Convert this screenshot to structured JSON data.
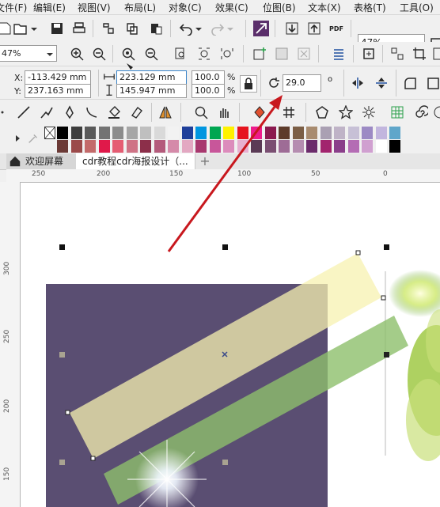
{
  "menu": [
    "文件(F)",
    "编辑(E)",
    "视图(V)",
    "布局(L)",
    "对象(C)",
    "效果(C)",
    "位图(B)",
    "文本(X)",
    "表格(T)",
    "工具(O)"
  ],
  "toolbar": {
    "zoom_level": "47%",
    "snap_level": "47%"
  },
  "property_bar": {
    "x_label": "X:",
    "x_value": "-113.429 mm",
    "y_label": "Y:",
    "y_value": "237.163 mm",
    "width_value": "223.129 mm",
    "height_value": "145.947 mm",
    "scale_x": "100.0",
    "scale_y": "100.0",
    "percent": "%",
    "rotation_value": "29.0",
    "rotation_unit": "o"
  },
  "palette": {
    "row1": [
      "#000000",
      "#3d3d3d",
      "#595959",
      "#737373",
      "#8c8c8c",
      "#a6a6a6",
      "#bfbfbf",
      "#d9d9d9",
      "#f2f2f2",
      "#1e3f9a",
      "#0096e0",
      "#00a651",
      "#fff200",
      "#e6141e",
      "#ee1c8c",
      "#8b1a4f",
      "#5d3b2a",
      "#7b5e45",
      "#a88b6f",
      "#aaa0b3",
      "#bfb3c7",
      "#c7c0d6",
      "#9c8ac4",
      "#c2b6de",
      "#5fa6ca"
    ],
    "row2": [
      "#6b3a36",
      "#9b4a4a",
      "#c36a6a",
      "#e0194a",
      "#e55d73",
      "#cf7386",
      "#8c2f4a",
      "#b45a7b",
      "#d58aa9",
      "#e3a8c2",
      "#a8386e",
      "#c8569a",
      "#dc8cbc",
      "#e7b0d1",
      "#5a3a55",
      "#7a4f72",
      "#9e6c96",
      "#b58db0",
      "#6b2b6b",
      "#a2246e",
      "#8a3e8a",
      "#b46cb4",
      "#d0a0d0",
      "#ffffff",
      "#000000"
    ]
  },
  "tabs": {
    "home_label": "欢迎屏幕",
    "doc_label": "cdr教程cdr海报设计（..."
  },
  "ruler_top": [
    "250",
    "200",
    "150",
    "100",
    "50",
    "0"
  ],
  "ruler_left": [
    "300",
    "250",
    "200",
    "150"
  ],
  "colors": {
    "purple_rect": "#5a4e72",
    "yellow_band": "#f7f2b0",
    "green_band": "#8dbf6c",
    "red_arrow": "#c8181e"
  }
}
